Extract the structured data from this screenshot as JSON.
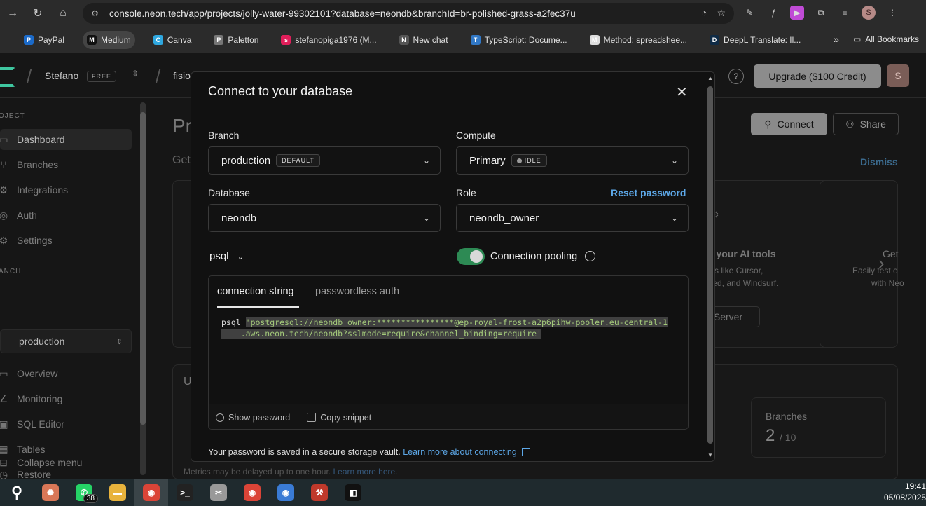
{
  "browser": {
    "url": "console.neon.tech/app/projects/jolly-water-99302101?database=neondb&branchId=br-polished-grass-a2fec37u",
    "bookmarks": [
      {
        "label": "PayPal",
        "icon": "paypal-icon",
        "color": "#1b6ac9"
      },
      {
        "label": "Medium",
        "icon": "medium-icon",
        "color": "#111111"
      },
      {
        "label": "Canva",
        "icon": "canva-icon",
        "color": "#2fa8e0"
      },
      {
        "label": "Paletton",
        "icon": "paletton-icon",
        "color": "#777777"
      },
      {
        "label": "stefanopiga1976 (M...",
        "icon": "slack-icon",
        "color": "#e01e5a"
      },
      {
        "label": "New chat",
        "icon": "openai-icon",
        "color": "#555555"
      },
      {
        "label": "TypeScript: Docume...",
        "icon": "typescript-icon",
        "color": "#3178c6"
      },
      {
        "label": "Method: spreadshee...",
        "icon": "google-icon",
        "color": "#dddddd"
      },
      {
        "label": "DeepL Translate: Il...",
        "icon": "deepl-icon",
        "color": "#0f2b46"
      }
    ],
    "all_bookmarks": "All Bookmarks",
    "profile_initial": "S"
  },
  "topbar": {
    "org": "Stefano",
    "plan": "FREE",
    "project_partial": "fisio",
    "upgrade_label": "Upgrade ($100 Credit)",
    "avatar_initial": "S"
  },
  "sidebar": {
    "project_section": "OJECT",
    "project_items": [
      {
        "label": "Dashboard",
        "icon": "dashboard-icon",
        "selected": true
      },
      {
        "label": "Branches",
        "icon": "branch-icon",
        "selected": false
      },
      {
        "label": "Integrations",
        "icon": "integrations-icon",
        "selected": false
      },
      {
        "label": "Auth",
        "icon": "auth-icon",
        "selected": false
      },
      {
        "label": "Settings",
        "icon": "gear-icon",
        "selected": false
      }
    ],
    "branch_section": "ANCH",
    "branch_name": "production",
    "branch_items": [
      {
        "label": "Overview",
        "icon": "overview-icon"
      },
      {
        "label": "Monitoring",
        "icon": "monitoring-icon"
      },
      {
        "label": "SQL Editor",
        "icon": "terminal-icon"
      },
      {
        "label": "Tables",
        "icon": "table-icon"
      },
      {
        "label": "Restore",
        "icon": "restore-icon"
      }
    ],
    "collapse_label": "Collapse menu"
  },
  "main": {
    "title_partial": "Pr",
    "subtitle_partial": "Get",
    "connect_label": "Connect",
    "share_label": "Share",
    "dismiss_label": "Dismiss",
    "ai_card_title": "h your AI tools",
    "ai_card_text_1": "nts like Cursor,",
    "ai_card_text_2": "Zed, and Windsurf.",
    "server_label": "Server",
    "third_card_title": "Get",
    "third_card_text_1": "Easily test o",
    "third_card_text_2": "with Neo",
    "usage_partial": "U",
    "branches_label": "Branches",
    "branches_value": "2",
    "branches_limit": "/ 10",
    "metrics_note": "Metrics may be delayed up to one hour.",
    "metrics_link": "Learn more here."
  },
  "modal": {
    "title": "Connect to your database",
    "branch_label": "Branch",
    "branch_value": "production",
    "branch_tag": "DEFAULT",
    "compute_label": "Compute",
    "compute_value": "Primary",
    "compute_tag": "IDLE",
    "database_label": "Database",
    "database_value": "neondb",
    "role_label": "Role",
    "role_value": "neondb_owner",
    "reset_password": "Reset password",
    "client_value": "psql",
    "pooling_label": "Connection pooling",
    "pooling_enabled": true,
    "tabs": [
      "connection string",
      "passwordless auth"
    ],
    "code_prefix": "psql",
    "code_line_1": "'postgresql://neondb_owner:****************@ep-royal-frost-a2p6pihw-pooler.eu-central-1",
    "code_line_2": "    .aws.neon.tech/neondb?sslmode=require&channel_binding=require'",
    "show_password": "Show password",
    "copy_snippet": "Copy snippet",
    "vault_text": "Your password is saved in a secure storage vault.",
    "vault_link": "Learn more about connecting"
  },
  "taskbar": {
    "apps": [
      {
        "name": "search-icon",
        "color": "transparent",
        "glyph": "⚲"
      },
      {
        "name": "claude-icon",
        "color": "#d97757",
        "glyph": "✺"
      },
      {
        "name": "whatsapp-icon",
        "color": "#25d366",
        "glyph": "✆",
        "badge": "38"
      },
      {
        "name": "file-explorer-icon",
        "color": "#e8b33c",
        "glyph": "▬"
      },
      {
        "name": "chrome-icon",
        "color": "#db4437",
        "glyph": "◉",
        "selected": true
      },
      {
        "name": "terminal-icon",
        "color": "#222222",
        "glyph": ">_"
      },
      {
        "name": "snipping-icon",
        "color": "#999999",
        "glyph": "✂"
      },
      {
        "name": "chrome-profile-icon",
        "color": "#db4437",
        "glyph": "◉"
      },
      {
        "name": "chrome-alt-icon",
        "color": "#3a7bd5",
        "glyph": "◉"
      },
      {
        "name": "tool-icon",
        "color": "#c0392b",
        "glyph": "⚒"
      },
      {
        "name": "box-icon",
        "color": "#111111",
        "glyph": "◧"
      }
    ],
    "time": "19:41",
    "date": "05/08/2025"
  }
}
